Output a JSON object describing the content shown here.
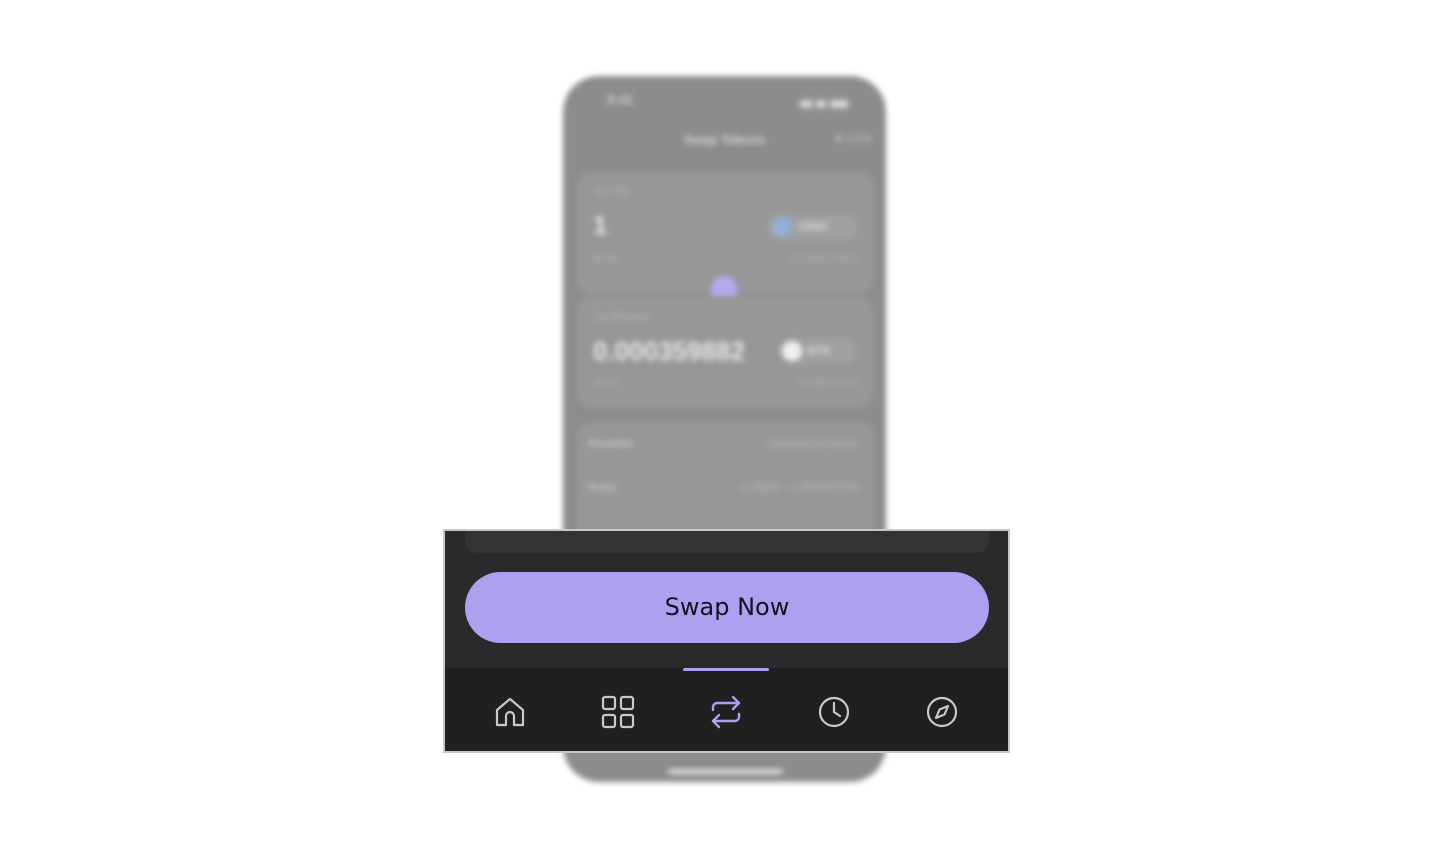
{
  "background": {
    "status_time": "9:41",
    "screen_title": "Swap Tokens",
    "slippage": "0.5%",
    "pay_card": {
      "label": "You Pay",
      "amount": "1",
      "usd_value": "$0.99",
      "token": "USDC",
      "balance": "2.24062 USDC"
    },
    "receive_card": {
      "label": "You Receive",
      "amount": "0.000359882",
      "usd_value": "$0.99",
      "token": "ETH",
      "balance": "0.00887 ETH"
    },
    "details": [
      {
        "label": "Provider",
        "value": "Uniswap V4 via 0x"
      },
      {
        "label": "Price",
        "value": "1 USDC = 0.00036 ETH"
      }
    ]
  },
  "action": {
    "swap_label": "Swap Now"
  },
  "tabbar": {
    "active_index": 2,
    "accent": "#aca1f0",
    "tabs": [
      {
        "name": "home",
        "icon": "home-icon"
      },
      {
        "name": "apps",
        "icon": "grid-icon"
      },
      {
        "name": "swap",
        "icon": "swap-arrows-icon"
      },
      {
        "name": "history",
        "icon": "clock-icon"
      },
      {
        "name": "explore",
        "icon": "compass-icon"
      }
    ]
  },
  "colors": {
    "accent": "#aca1f0",
    "panel_bg": "#2a2a2c",
    "tabbar_bg": "#202020",
    "icon_inactive": "#c9c9c9"
  }
}
